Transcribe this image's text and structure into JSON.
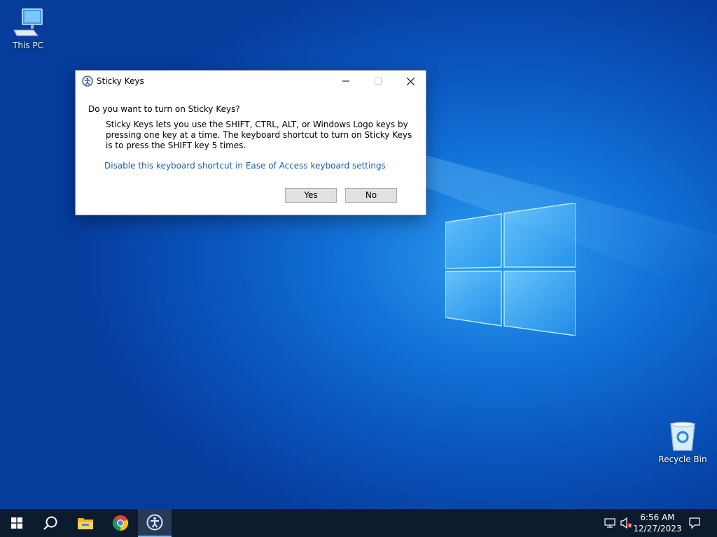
{
  "desktop": {
    "icons": [
      {
        "label": "This PC"
      },
      {
        "label": "Recycle Bin"
      }
    ]
  },
  "dialog": {
    "title": "Sticky Keys",
    "question": "Do you want to turn on Sticky Keys?",
    "description": "Sticky Keys lets you use the SHIFT, CTRL, ALT, or Windows Logo keys by pressing one key at a time. The keyboard shortcut to turn on Sticky Keys is to press the SHIFT key 5 times.",
    "link": "Disable this keyboard shortcut in Ease of Access keyboard settings",
    "yes_label": "Yes",
    "no_label": "No"
  },
  "taskbar": {
    "items": [
      "start-icon",
      "search-icon",
      "file-explorer-icon",
      "chrome-icon",
      "ease-of-access-icon"
    ],
    "time": "6:56 AM",
    "date": "12/27/2023"
  },
  "colors": {
    "link": "#1c5ea8",
    "taskbar": "#0d1b2e",
    "desktop_accent": "#1273d8"
  }
}
